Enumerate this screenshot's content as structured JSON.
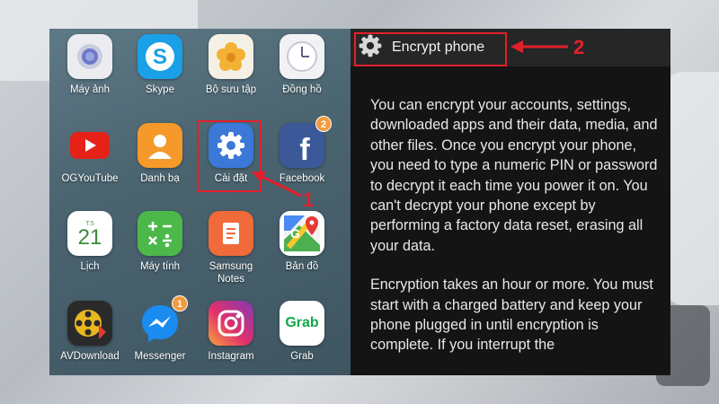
{
  "launcher": {
    "apps": [
      {
        "id": "camera",
        "label": "Máy ảnh",
        "icon": "camera-icon",
        "color": "#e8e8ec",
        "badge": ""
      },
      {
        "id": "skype",
        "label": "Skype",
        "icon": "skype-icon",
        "color": "#1aa0e6",
        "badge": ""
      },
      {
        "id": "gallery",
        "label": "Bộ sưu tập",
        "icon": "gallery-flower-icon",
        "color": "#f5f0e6",
        "badge": ""
      },
      {
        "id": "clock",
        "label": "Đồng hồ",
        "icon": "clock-icon",
        "color": "#f2f2f4",
        "badge": ""
      },
      {
        "id": "ogyoutube",
        "label": "OGYouTube",
        "icon": "youtube-icon",
        "color": "#ffffff",
        "badge": ""
      },
      {
        "id": "contacts",
        "label": "Danh bạ",
        "icon": "contacts-icon",
        "color": "#f59a2a",
        "badge": ""
      },
      {
        "id": "settings",
        "label": "Cài đặt",
        "icon": "gear-icon",
        "color": "#3b78d8",
        "badge": ""
      },
      {
        "id": "facebook",
        "label": "Facebook",
        "icon": "facebook-icon",
        "color": "#3b5998",
        "badge": "2"
      },
      {
        "id": "calendar",
        "label": "Lịch",
        "icon": "calendar-icon",
        "color": "#ffffff",
        "badge": "",
        "day": "21",
        "weekday": "T.5"
      },
      {
        "id": "calculator",
        "label": "Máy tính",
        "icon": "calculator-icon",
        "color": "#4cb84a",
        "badge": ""
      },
      {
        "id": "samsungnotes",
        "label": "Samsung Notes",
        "icon": "notes-icon",
        "color": "#f06a3a",
        "badge": ""
      },
      {
        "id": "maps",
        "label": "Bản đồ",
        "icon": "maps-icon",
        "color": "#ffffff",
        "badge": ""
      },
      {
        "id": "avdownload",
        "label": "AVDownload",
        "icon": "film-reel-icon",
        "color": "#2a2a2a",
        "badge": ""
      },
      {
        "id": "messenger",
        "label": "Messenger",
        "icon": "messenger-icon",
        "color": "#1a8cf0",
        "badge": "1"
      },
      {
        "id": "instagram",
        "label": "Instagram",
        "icon": "instagram-icon",
        "color": "#c13584",
        "badge": ""
      },
      {
        "id": "grab",
        "label": "Grab",
        "icon": "grab-icon",
        "color": "#ffffff",
        "badge": "",
        "text": "Grab"
      }
    ]
  },
  "encrypt": {
    "title": "Encrypt phone",
    "paragraph1": "You can encrypt your accounts, settings, downloaded apps and their data, media, and other files. Once you encrypt your phone, you need to type a numeric PIN or password to decrypt it each time you power it on. You can't decrypt your phone except by performing a factory data reset, erasing all your data.",
    "paragraph2": "Encryption takes an hour or more. You must start with a charged battery and keep your phone plugged in until encryption is complete. If you interrupt the"
  },
  "annotations": {
    "step1": "1",
    "step2": "2",
    "color": "#e2202a"
  }
}
